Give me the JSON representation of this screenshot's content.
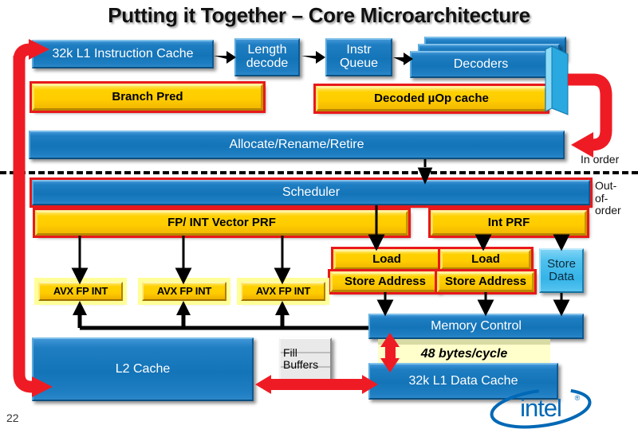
{
  "slide": {
    "title": "Putting it Together – Core Microarchitecture",
    "page_number": "22",
    "logo_text": "intel",
    "logo_trademark": "®"
  },
  "colors": {
    "blue": "#1474b8",
    "gold": "#ffcc00",
    "red": "#e8191b",
    "cyan": "#35b4e8",
    "grey": "#c8c8c8",
    "callout_bg": "#ffffcc",
    "text_dark": "#111111"
  },
  "frontend": {
    "l1_instruction_cache": "32k L1 Instruction Cache",
    "length_decode": "Length\ndecode",
    "instr_queue": "Instr\nQueue",
    "decoders": "Decoders",
    "branch_pred": "Branch Pred",
    "uop_cache": "Decoded µOp cache"
  },
  "midcore": {
    "allocate_rename_retire": "Allocate/Rename/Retire",
    "in_order_label": "In order",
    "out_of_order_label": "Out-\nof-\norder",
    "scheduler": "Scheduler"
  },
  "registers": {
    "fp_int_vector_prf": "FP/ INT Vector PRF",
    "int_prf": "Int PRF"
  },
  "execution_units": [
    {
      "label": "AVX FP INT"
    },
    {
      "label": "AVX FP INT"
    },
    {
      "label": "AVX FP INT"
    }
  ],
  "memory_ports": [
    {
      "top": "Load",
      "bottom": "Store Address"
    },
    {
      "top": "Load",
      "bottom": "Store Address"
    }
  ],
  "store_data": {
    "line1": "Store",
    "line2": "Data"
  },
  "memory": {
    "memory_control": "Memory Control",
    "bandwidth_callout": "48 bytes/cycle",
    "l1_data_cache": "32k L1 Data Cache",
    "l2_cache": "L2 Cache",
    "fill_buffers_line1": "Fill",
    "fill_buffers_line2": "Buffers"
  }
}
